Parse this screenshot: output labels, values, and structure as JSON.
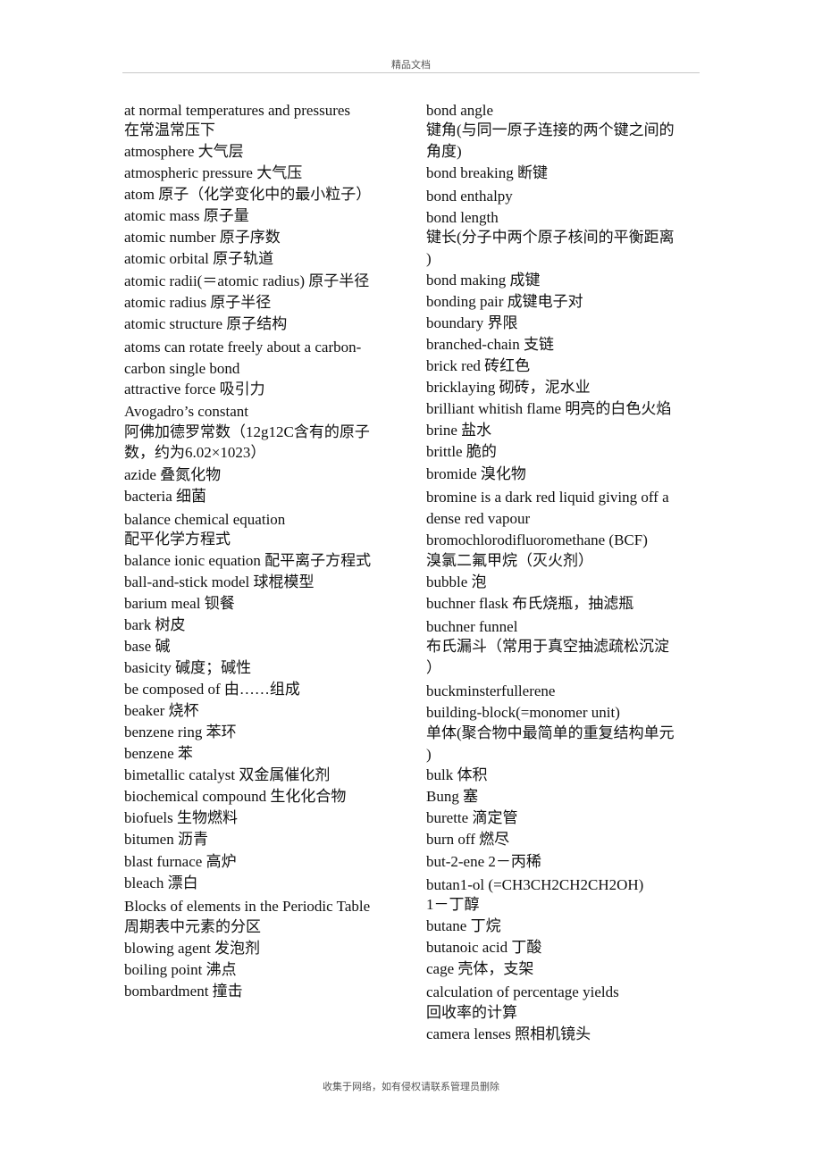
{
  "header": {
    "title": "精品文档"
  },
  "footer": {
    "text": "收集于网络，如有侵权请联系管理员删除"
  },
  "left_column": [
    "at normal temperatures and pressures",
    "在常温常压下",
    "atmosphere 大气层",
    "atmospheric pressure 大气压",
    "atom 原子（化学变化中的最小粒子）",
    "atomic mass 原子量",
    "atomic number 原子序数",
    "atomic orbital 原子轨道",
    "atomic radii(＝atomic radius) 原子半径",
    "atomic radius 原子半径",
    "atomic structure 原子结构",
    "atoms can rotate freely about a carbon-",
    "carbon single bond",
    "attractive force 吸引力",
    "Avogadro’s constant",
    "阿佛加德罗常数（12g12C含有的原子",
    "数，约为6.02×1023）",
    "azide 叠氮化物",
    "bacteria 细菌",
    "balance chemical equation",
    "配平化学方程式",
    "balance ionic equation 配平离子方程式",
    "ball-and-stick model 球棍模型",
    "barium meal 钡餐",
    "bark 树皮",
    "base 碱",
    "basicity 碱度；碱性",
    "be composed of 由……组成",
    "beaker 烧杯",
    "benzene ring 苯环",
    "benzene 苯",
    "bimetallic catalyst 双金属催化剂",
    "biochemical compound 生化化合物",
    "biofuels 生物燃料",
    "bitumen 沥青",
    "blast furnace 高炉",
    "bleach 漂白",
    "Blocks of elements in the Periodic Table",
    "周期表中元素的分区",
    "blowing agent 发泡剂",
    "boiling point 沸点",
    "bombardment 撞击"
  ],
  "right_column": [
    "bond angle",
    "键角(与同一原子连接的两个键之间的",
    "角度)",
    "bond breaking 断键",
    "bond enthalpy",
    "bond length",
    "键长(分子中两个原子核间的平衡距离",
    ")",
    "bond making 成键",
    "bonding pair 成键电子对",
    "boundary 界限",
    "branched-chain 支链",
    "brick red 砖红色",
    "bricklaying 砌砖，泥水业",
    "brilliant whitish flame 明亮的白色火焰",
    "brine 盐水",
    "brittle 脆的",
    "bromide 溴化物",
    "bromine is a dark red liquid giving off a",
    "dense red vapour",
    "bromochlorodifluoromethane (BCF)",
    "溴氯二氟甲烷（灭火剂）",
    "bubble 泡",
    "buchner flask 布氏烧瓶，抽滤瓶",
    "buchner funnel",
    "布氏漏斗（常用于真空抽滤疏松沉淀",
    "）",
    "buckminsterfullerene",
    "building-block(=monomer unit)",
    "单体(聚合物中最简单的重复结构单元",
    ")",
    "bulk 体积",
    "Bung 塞",
    "burette 滴定管",
    "burn off 燃尽",
    "but-2-ene 2－丙稀",
    "butan1-ol (=CH3CH2CH2CH2OH)",
    "1－丁醇",
    "butane 丁烷",
    "butanoic acid 丁酸",
    "cage 壳体，支架",
    "calculation of percentage yields",
    "回收率的计算",
    "camera lenses 照相机镜头"
  ]
}
